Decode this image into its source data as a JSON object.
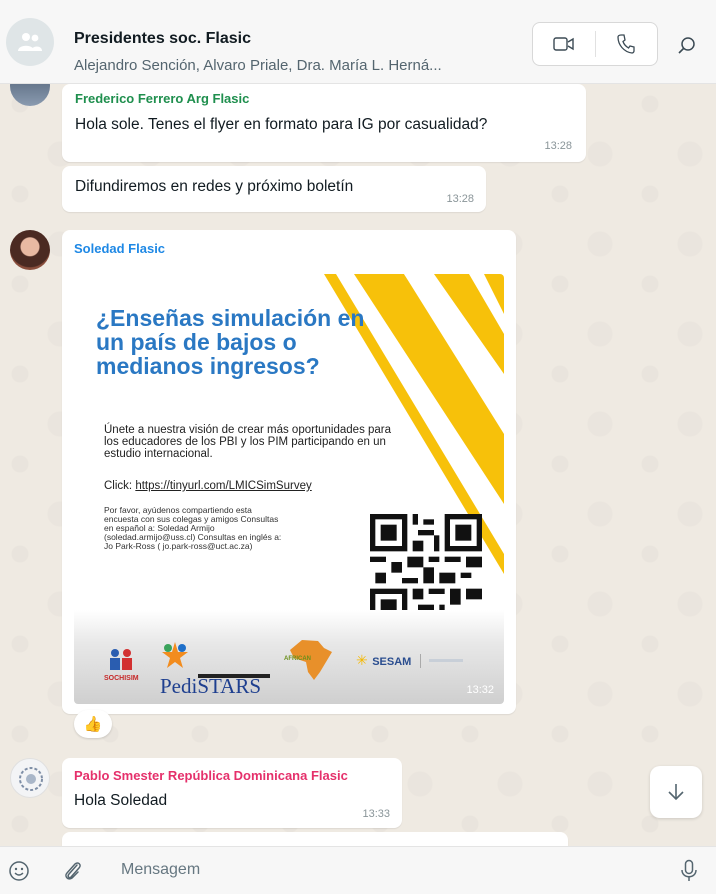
{
  "header": {
    "title": "Presidentes soc. Flasic",
    "participants": "Alejandro Sención, Alvaro Priale, Dra. María L. Herná..."
  },
  "messages": [
    {
      "sender": "Frederico Ferrero Arg Flasic",
      "text": "Hola sole. Tenes el flyer en formato para IG por casualidad?",
      "time": "13:28"
    },
    {
      "text": "Difundiremos en redes y próximo boletín",
      "time": "13:28"
    },
    {
      "sender": "Soledad Flasic",
      "time": "13:32",
      "reaction": "👍"
    },
    {
      "sender": "Pablo Smester República Dominicana Flasic",
      "text": "Hola Soledad",
      "time": "13:33"
    }
  ],
  "flyer": {
    "title": "¿Enseñas simulación en un país de bajos o medianos ingresos?",
    "body": "Únete a nuestra visión de crear más oportunidades para los educadores de los PBI y los PIM participando en un estudio internacional.",
    "click_label": "Click:",
    "link": "https://tinyurl.com/LMICSimSurvey",
    "small": "Por favor, ayúdenos compartiendo esta encuesta con sus colegas y amigos Consultas en español a: Soledad Armijo (soledad.armijo@uss.cl) Consultas en inglés a: Jo Park-Ross ( jo.park-ross@uct.ac.za)",
    "logos": [
      "SOCHISIM",
      "PediSTARS",
      "AFRICAN",
      "SESAM"
    ]
  },
  "input": {
    "placeholder": "Mensagem"
  },
  "colors": {
    "sender_green": "#1f8f4e",
    "sender_blue": "#1e88e5",
    "sender_pink": "#e5306b",
    "flyer_blue": "#2a78c3",
    "flyer_yellow": "#f7c10a"
  }
}
